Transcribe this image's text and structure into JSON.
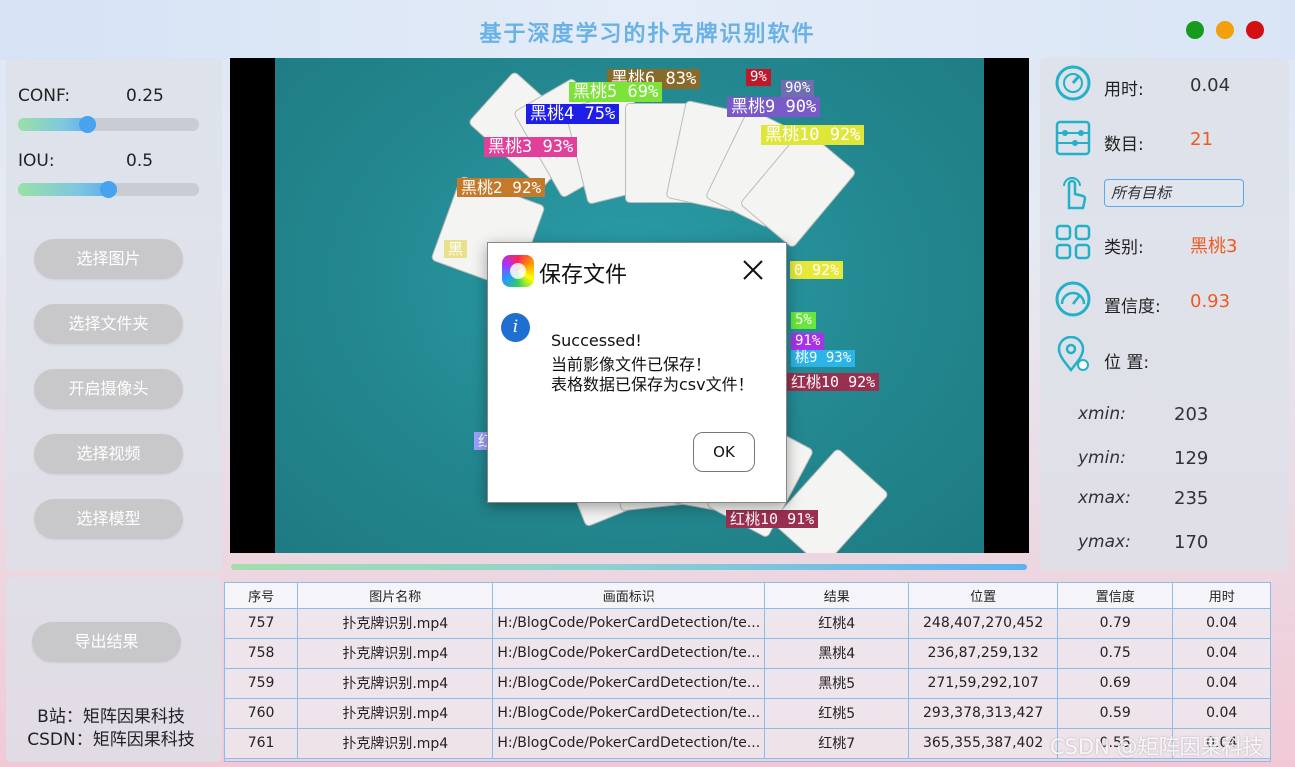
{
  "app": {
    "title": "基于深度学习的扑克牌识别软件",
    "window_controls": [
      "minimize-green",
      "restore-yellow",
      "close-red"
    ]
  },
  "params": {
    "conf_label": "CONF:",
    "conf_value": "0.25",
    "conf_fraction": 0.25,
    "iou_label": "IOU:",
    "iou_value": "0.5",
    "iou_fraction": 0.5
  },
  "sidebar": {
    "buttons": [
      "选择图片",
      "选择文件夹",
      "开启摄像头",
      "选择视频",
      "选择模型"
    ],
    "export_label": "导出结果",
    "credit_line1": "B站：矩阵因果科技",
    "credit_line2": "CSDN：矩阵因果科技"
  },
  "dialog": {
    "title": "保存文件",
    "line1": "Successed!",
    "line2": "当前影像文件已保存！",
    "line3": "表格数据已保存为csv文件！",
    "ok_label": "OK",
    "info_icon": "i"
  },
  "detections": [
    {
      "text": "黑桃6 83%",
      "color": "#8a6a2a"
    },
    {
      "text": "9%",
      "color": "#c0182a"
    },
    {
      "text": "黑桃5 69%",
      "color": "#7de23a"
    },
    {
      "text": "90%",
      "color": "#6f6fb0"
    },
    {
      "text": "黑桃4 75%",
      "color": "#1e1ee8"
    },
    {
      "text": "黑桃9 90%",
      "color": "#7a5ac8"
    },
    {
      "text": "黑桃3 93%",
      "color": "#e0409a"
    },
    {
      "text": "黑桃10 92%",
      "color": "#dfe63a"
    },
    {
      "text": "黑桃2 92%",
      "color": "#c5792a"
    },
    {
      "text": "0 92%",
      "color": "#e8e83a"
    },
    {
      "text": "5%",
      "color": "#6ae83a"
    },
    {
      "text": "91%",
      "color": "#a832e8"
    },
    {
      "text": "桃9 93%",
      "color": "#2ab4e8"
    },
    {
      "text": "红桃10 92%",
      "color": "#9a3050"
    },
    {
      "text": "红桃10 91%",
      "color": "#9a3050"
    },
    {
      "text": "黑",
      "color": "#e8e08a"
    },
    {
      "text": "红",
      "color": "#a0a0ff"
    }
  ],
  "stats": {
    "time_label": "用时:",
    "time_value": "0.04",
    "count_label": "数目:",
    "count_value": "21",
    "target_placeholder": "所有目标",
    "class_label": "类别:",
    "class_value": "黑桃3",
    "conf_label": "置信度:",
    "conf_value": "0.93",
    "pos_label": "位 置:",
    "xmin_label": "xmin:",
    "xmin": "203",
    "ymin_label": "ymin:",
    "ymin": "129",
    "xmax_label": "xmax:",
    "xmax": "235",
    "ymax_label": "ymax:",
    "ymax": "170",
    "value_color": "#f05a1e"
  },
  "table": {
    "headers": [
      "序号",
      "图片名称",
      "画面标识",
      "结果",
      "位置",
      "置信度",
      "用时"
    ],
    "rows": [
      [
        "757",
        "扑克牌识别.mp4",
        "H:/BlogCode/PokerCardDetection/te...",
        "红桃4",
        "248,407,270,452",
        "0.79",
        "0.04"
      ],
      [
        "758",
        "扑克牌识别.mp4",
        "H:/BlogCode/PokerCardDetection/te...",
        "黑桃4",
        "236,87,259,132",
        "0.75",
        "0.04"
      ],
      [
        "759",
        "扑克牌识别.mp4",
        "H:/BlogCode/PokerCardDetection/te...",
        "黑桃5",
        "271,59,292,107",
        "0.69",
        "0.04"
      ],
      [
        "760",
        "扑克牌识别.mp4",
        "H:/BlogCode/PokerCardDetection/te...",
        "红桃5",
        "293,378,313,427",
        "0.59",
        "0.04"
      ],
      [
        "761",
        "扑克牌识别.mp4",
        "H:/BlogCode/PokerCardDetection/te...",
        "红桃7",
        "365,355,387,402",
        "0.55",
        "0.04"
      ]
    ]
  },
  "watermark": "CSDN @矩阵因果科技"
}
